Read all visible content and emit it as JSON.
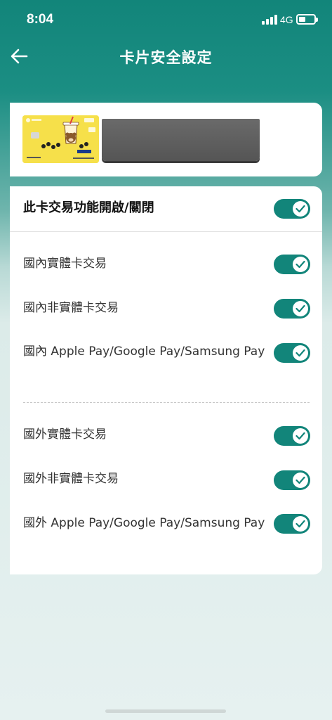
{
  "status_bar": {
    "time": "8:04",
    "network": "4G"
  },
  "header": {
    "title": "卡片安全設定"
  },
  "master_toggle": {
    "label": "此卡交易功能開啟/關閉",
    "on": true
  },
  "domestic": [
    {
      "label": "國內實體卡交易",
      "on": true
    },
    {
      "label": "國內非實體卡交易",
      "on": true
    },
    {
      "label": "國內 Apple Pay/Google Pay/Samsung Pay",
      "on": true
    }
  ],
  "overseas": [
    {
      "label": "國外實體卡交易",
      "on": true
    },
    {
      "label": "國外非實體卡交易",
      "on": true
    },
    {
      "label": "國外 Apple Pay/Google Pay/Samsung Pay",
      "on": true
    }
  ],
  "colors": {
    "accent": "#12857a",
    "toggle_on": "#12857a",
    "card_yellow": "#f6e04a"
  }
}
